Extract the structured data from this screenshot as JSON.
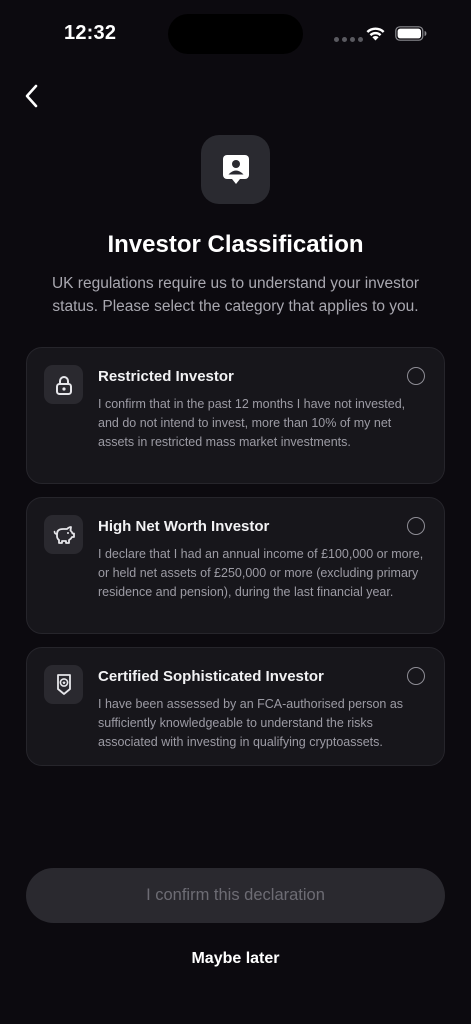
{
  "status_bar": {
    "time": "12:32"
  },
  "header": {
    "title": "Investor Classification",
    "subtitle": "UK regulations require us to understand your investor status. Please select the category that applies to you."
  },
  "options": [
    {
      "icon": "lock-icon",
      "title": "Restricted Investor",
      "description": "I confirm that in the past 12 months I have not invested, and do not intend to invest, more than 10% of my net assets in restricted mass market investments.",
      "selected": false
    },
    {
      "icon": "piggy-bank-icon",
      "title": "High Net Worth Investor",
      "description": "I declare that I had an annual income of £100,000 or more, or held net assets of £250,000 or more (excluding primary residence and pension), during the last financial year.",
      "selected": false
    },
    {
      "icon": "award-badge-icon",
      "title": "Certified Sophisticated Investor",
      "description": "I have been assessed by an FCA-authorised person as sufficiently knowledgeable to understand the risks associated with investing in qualifying cryptoassets.",
      "selected": false
    }
  ],
  "actions": {
    "confirm_label": "I confirm this declaration",
    "later_label": "Maybe later"
  },
  "colors": {
    "background": "#0c0a0f",
    "card": "#17161b",
    "button_disabled": "#2a292f"
  }
}
